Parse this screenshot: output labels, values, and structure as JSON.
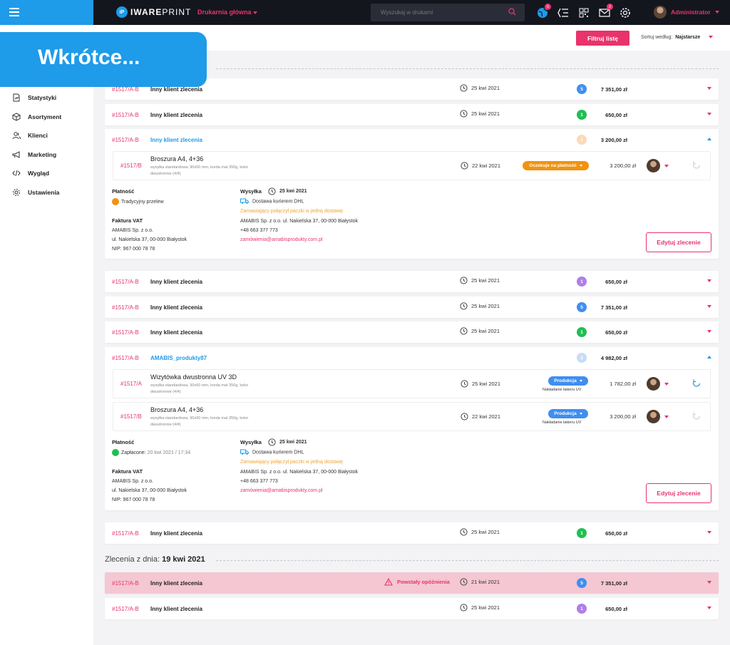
{
  "app": {
    "brand_mark": "iP",
    "brand_bold": "IWARE",
    "brand_light": "PRINT",
    "printery": "Drukarnia główna",
    "search_placeholder": "Wyszukaj w drukarni",
    "globe_badge": "5",
    "mail_badge": "2",
    "user_name": "Administrator",
    "accent": "#e8336d",
    "blue": "#1e9be9"
  },
  "sidebar": {
    "banner": "Wkrótce...",
    "items": [
      {
        "label": "Statystyki",
        "icon": "stats-icon"
      },
      {
        "label": "Asortyment",
        "icon": "box-icon"
      },
      {
        "label": "Klienci",
        "icon": "users-icon"
      },
      {
        "label": "Marketing",
        "icon": "megaphone-icon"
      },
      {
        "label": "Wygląd",
        "icon": "code-icon"
      },
      {
        "label": "Ustawienia",
        "icon": "gear-icon"
      }
    ]
  },
  "filterbar": {
    "filter_label": "Filtruj listę",
    "sort_label": "Sortuj według:",
    "sort_value": "Najstarsze"
  },
  "group2": {
    "prefix": "Zlecenia z dnia:",
    "date": "19 kwi 2021"
  },
  "rows": [
    {
      "id": "#1517/A-B",
      "name": "Inny klient zlecenia",
      "date": "25 kwi 2021",
      "count": "5",
      "count_color": "#3f8ef0",
      "amount": "7 351,00 zł"
    },
    {
      "id": "#1517/A-B",
      "name": "Inny klient zlecenia",
      "date": "25 kwi 2021",
      "count": "1",
      "count_color": "#1fbf52",
      "amount": "650,00 zł"
    },
    {
      "id": "#1517/A-B",
      "name": "Inny klient zlecenia",
      "date": "",
      "count": "1",
      "count_color": "#fbd9b8",
      "amount": "3 200,00 zł"
    },
    {
      "id": "#1517/A-B",
      "name": "Inny klient zlecenia",
      "date": "25 kwi 2021",
      "count": "1",
      "count_color": "#b07ee8",
      "amount": "650,00 zł"
    },
    {
      "id": "#1517/A-B",
      "name": "Inny klient zlecenia",
      "date": "25 kwi 2021",
      "count": "5",
      "count_color": "#3f8ef0",
      "amount": "7 351,00 zł"
    },
    {
      "id": "#1517/A-B",
      "name": "Inny klient zlecenia",
      "date": "25 kwi 2021",
      "count": "1",
      "count_color": "#1fbf52",
      "amount": "650,00 zł"
    },
    {
      "id": "#1517/A-B",
      "name": "AMABIS_produkty87",
      "date": "",
      "count": "2",
      "count_color": "#c8dcf5",
      "amount": "4 982,00 zł"
    },
    {
      "id": "#1517/A-B",
      "name": "Inny klient zlecenia",
      "date": "25 kwi 2021",
      "count": "1",
      "count_color": "#1fbf52",
      "amount": "650,00 zł"
    },
    {
      "id": "#1517/A-B",
      "name": "Inny klient zlecenia",
      "date": "21 kwi 2021",
      "count": "5",
      "count_color": "#3f8ef0",
      "amount": "7 351,00 zł",
      "warning": "Powstały opóźnienia"
    },
    {
      "id": "#1517/A-B",
      "name": "Inny klient zlecenia",
      "date": "25 kwi 2021",
      "count": "1",
      "count_color": "#b07ee8",
      "amount": "650,00 zł"
    }
  ],
  "exp1": {
    "sub": {
      "id": "#1517/B",
      "name": "Broszura A4, 4+36",
      "desc": "wysyłka standardowa, 90x50 mm, kreda mat 350g, kolor dwustronnie (4/4)",
      "date": "22 kwi 2021",
      "status": "Oczekuje na płatność",
      "status_color": "#f2920f",
      "amount": "3 200,00 zł"
    },
    "payment_label": "Płatność",
    "payment_method": "Tradycyjny przelew",
    "invoice_label": "Faktura VAT",
    "invoice_lines": [
      "AMABIS Sp. z o.o.",
      "ul. Nakielska 37, 00-000 Białystok",
      "NIP: 967 000 78 78"
    ],
    "shipping_label": "Wysyłka",
    "shipping_date": "25 kwi 2021",
    "courier": "Dostawa kurierem DHL",
    "note": "Zamawiający połączył paczki w jedną dostawę.",
    "address": "AMABIS Sp. z o.o. ul. Nakielska 37, 00-000 Białystok",
    "phone": "+48 663 377 773",
    "email": "zamówienia@amabisprodukty.com.pl",
    "edit_label": "Edytuj zlecenie"
  },
  "exp2": {
    "subs": [
      {
        "id": "#1517/A",
        "name": "Wizytówka dwustronna UV 3D",
        "desc": "wysyłka standardowa, 90x50 mm, kreda mat 350g, kolor dwustronnie (4/4)",
        "date": "25 kwi 2021",
        "status": "Produkcja",
        "status_note": "Nakładanie lakieru UV",
        "status_color": "#3f8ef0",
        "amount": "1 782,00 zł"
      },
      {
        "id": "#1517/B",
        "name": "Broszura A4, 4+36",
        "desc": "wysyłka standardowa, 90x50 mm, kreda mat 350g, kolor dwustronnie (4/4)",
        "date": "22 kwi 2021",
        "status": "Produkcja",
        "status_note": "Nakładanie lakieru UV",
        "status_color": "#3f8ef0",
        "amount": "3 200,00 zł"
      }
    ],
    "payment_label": "Płatność",
    "payment_paid": "Zapłacone:",
    "payment_when": "20 kwi 2021 / 17:34",
    "invoice_label": "Faktura VAT",
    "invoice_lines": [
      "AMABIS Sp. z o.o.",
      "ul. Nakielska 37, 00-000 Białystok",
      "NIP: 967 000 78 78"
    ],
    "shipping_label": "Wysyłka",
    "shipping_date": "25 kwi 2021",
    "courier": "Dostawa kurierem DHL",
    "note": "Zamawiający połączył paczki w jedną dostawę.",
    "address": "AMABIS Sp. z o.o. ul. Nakielska 37, 00-000 Białystok",
    "phone": "+48 663 377 773",
    "email": "zamówienia@amabisprodukty.com.pl",
    "edit_label": "Edytuj zlecenie"
  }
}
